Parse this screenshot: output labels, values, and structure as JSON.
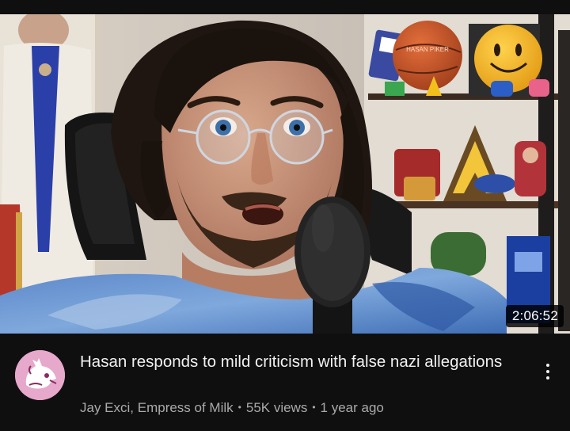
{
  "video": {
    "title": "Hasan responds to mild criticism with false nazi allegations",
    "duration": "2:06:52",
    "channel": "Jay Exci, Empress of Milk",
    "views": "55K views",
    "age": "1 year ago",
    "separator": "•"
  },
  "thumbnail": {
    "ball_text": "HASAN PIKER"
  },
  "icons": {
    "more": "more-vert-icon",
    "avatar": "dragon-avatar-icon"
  },
  "colors": {
    "background": "#0f0f0f",
    "title_text": "#f1f1f1",
    "meta_text": "#aaaaaa",
    "avatar_bg": "#e5a7c9"
  }
}
